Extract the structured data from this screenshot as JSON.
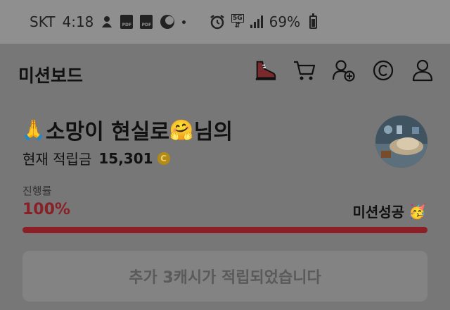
{
  "status_bar": {
    "carrier": "SKT",
    "time": "4:18",
    "pdf_label": "PDF",
    "network": "5G",
    "battery": "69%",
    "battery_level": 0.69,
    "icons": [
      "wallet-bell-icon",
      "pdf-icon",
      "pdf-icon",
      "moon-icon",
      "dot-icon",
      "alarm-icon",
      "5g-icon",
      "signal-icon",
      "battery-icon"
    ]
  },
  "header": {
    "title": "미션보드",
    "icons": [
      "shoe-icon",
      "cart-icon",
      "add-user-icon",
      "coin-icon",
      "profile-icon"
    ]
  },
  "greeting": {
    "prefix_emoji": "🙏",
    "name": "소망이 현실로",
    "name_emoji": "🤗",
    "suffix": "님의"
  },
  "points": {
    "label": "현재 적립금",
    "value": "15,301",
    "coin_symbol": "C"
  },
  "progress": {
    "label": "진행률",
    "value_text": "100%",
    "value": 1.0,
    "status": "미션성공",
    "status_emoji": "🥳"
  },
  "notice": {
    "text": "추가 3캐시가 적립되었습니다"
  },
  "colors": {
    "accent": "#8b1f26",
    "coin": "#b38a17",
    "overlay": "#777777"
  }
}
